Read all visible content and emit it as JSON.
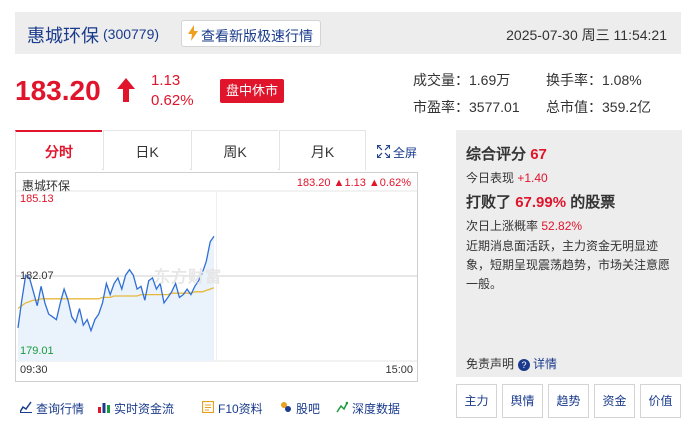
{
  "header": {
    "stock_name": "惠城环保",
    "stock_code": "(300779)",
    "new_version_label": "查看新版极速行情",
    "datetime": "2025-07-30 周三 11:54:21"
  },
  "quote": {
    "price": "183.20",
    "change": "1.13",
    "change_pct": "0.62%",
    "status": "盘中休市"
  },
  "stats": {
    "volume": "成交量：1.69万",
    "turnover": "换手率：1.08%",
    "pe": "市盈率：3577.01",
    "market_cap": "总市值：359.2亿"
  },
  "tabs": [
    "分时",
    "日K",
    "周K",
    "月K"
  ],
  "fullscreen_label": "全屏",
  "chart": {
    "title": "惠城环保",
    "quote_text": "183.20 ▲1.13 ▲0.62%",
    "y_high": "185.13",
    "y_mid": "182.07",
    "y_low": "179.01",
    "x_start": "09:30",
    "x_end": "15:00",
    "watermark": "东方财富",
    "colors": {
      "price_line": "#2f6fd6",
      "avg_line": "#e8b83a",
      "up": "#e0142b",
      "down": "#1a9a3c"
    }
  },
  "chart_data": {
    "type": "line",
    "title": "惠城环保",
    "xlabel": "",
    "ylabel": "",
    "ylim": [
      179.01,
      185.13
    ],
    "x_range": [
      "09:30",
      "15:00"
    ],
    "ref_price": 182.07,
    "series": [
      {
        "name": "",
        "values": [
          180.2,
          181.2,
          182.1,
          182.0,
          181.5,
          181.0,
          181.7,
          181.1,
          180.7,
          180.6,
          180.5,
          181.1,
          181.6,
          181.2,
          180.6,
          180.4,
          180.9,
          180.3,
          180.5,
          180.1,
          180.5,
          180.7,
          181.1,
          181.8,
          181.4,
          181.8,
          182.0,
          181.6,
          182.1,
          182.3,
          182.1,
          181.6,
          181.7,
          181.2,
          181.9,
          182.0,
          181.6,
          181.8,
          181.1,
          181.3,
          181.5,
          181.8,
          181.3,
          181.4,
          181.6,
          181.4,
          181.7,
          181.9,
          182.2,
          182.6,
          183.3,
          183.5
        ]
      },
      {
        "name": "",
        "values": [
          180.9,
          181.0,
          181.1,
          181.15,
          181.2,
          181.2,
          181.25,
          181.25,
          181.25,
          181.25,
          181.25,
          181.25,
          181.25,
          181.25,
          181.25,
          181.25,
          181.25,
          181.25,
          181.25,
          181.25,
          181.25,
          181.25,
          181.3,
          181.3,
          181.3,
          181.35,
          181.35,
          181.35,
          181.35,
          181.35,
          181.35,
          181.35,
          181.4,
          181.4,
          181.4,
          181.4,
          181.4,
          181.4,
          181.4,
          181.4,
          181.45,
          181.45,
          181.45,
          181.45,
          181.45,
          181.45,
          181.5,
          181.5,
          181.5,
          181.55,
          181.6,
          181.65
        ]
      }
    ],
    "grid": true
  },
  "toolbar": [
    "查询行情",
    "实时资金流",
    "F10资料",
    "股吧",
    "深度数据"
  ],
  "score_panel": {
    "title": "综合评分",
    "score": "67",
    "today_label": "今日表现",
    "today_value": "+1.40",
    "beat_prefix": "打败了",
    "beat_pct": "67.99%",
    "beat_suffix": "的股票",
    "prob_label": "次日上涨概率",
    "prob_value": "52.82%",
    "description": "近期消息面活跃，主力资金无明显迹象，短期呈现震荡趋势，市场关注意愿一般。",
    "disclaimer": "免责声明",
    "details": "详情"
  },
  "score_buttons": [
    "主力",
    "舆情",
    "趋势",
    "资金",
    "价值"
  ]
}
